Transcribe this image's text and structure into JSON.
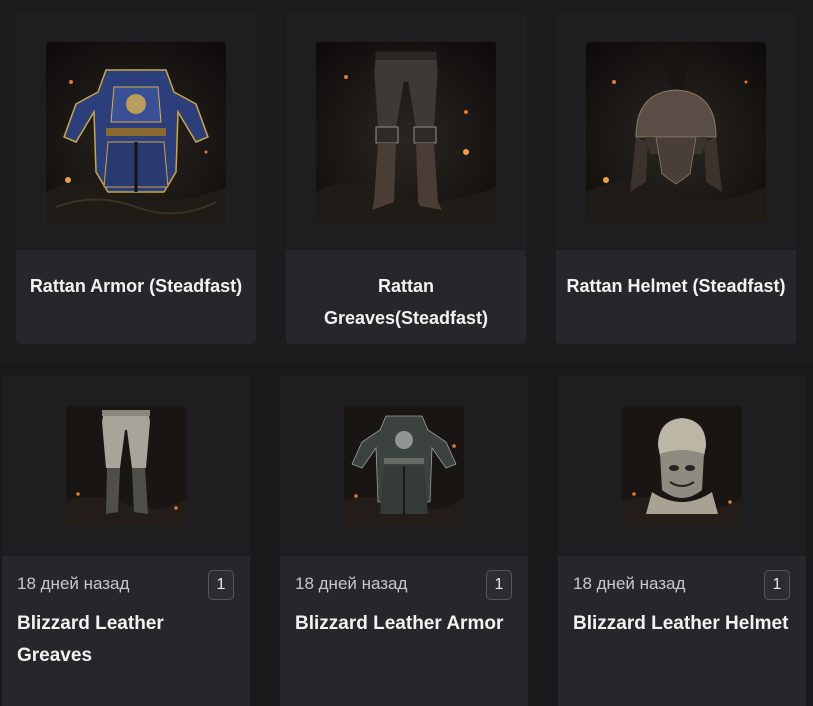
{
  "top_items": [
    {
      "title": "Rattan Armor (Steadfast)",
      "icon": "armor-icon",
      "accent": "#3a4f8f"
    },
    {
      "title": "Rattan Greaves(Steadfast)",
      "icon": "greaves-icon",
      "accent": "#4a4540"
    },
    {
      "title": "Rattan Helmet (Steadfast)",
      "icon": "helmet-icon",
      "accent": "#6b5a4a"
    }
  ],
  "bottom_items": [
    {
      "date": "18 дней назад",
      "count": "1",
      "name": "Blizzard Leather Greaves",
      "icon": "leather-greaves-icon"
    },
    {
      "date": "18 дней назад",
      "count": "1",
      "name": "Blizzard Leather Armor",
      "icon": "leather-armor-icon"
    },
    {
      "date": "18 дней назад",
      "count": "1",
      "name": "Blizzard Leather Helmet",
      "icon": "leather-helmet-icon"
    }
  ],
  "colors": {
    "background": "#19191c",
    "card": "#27272b",
    "text": "#f2f2f2",
    "muted_text": "#c8c8cc"
  }
}
